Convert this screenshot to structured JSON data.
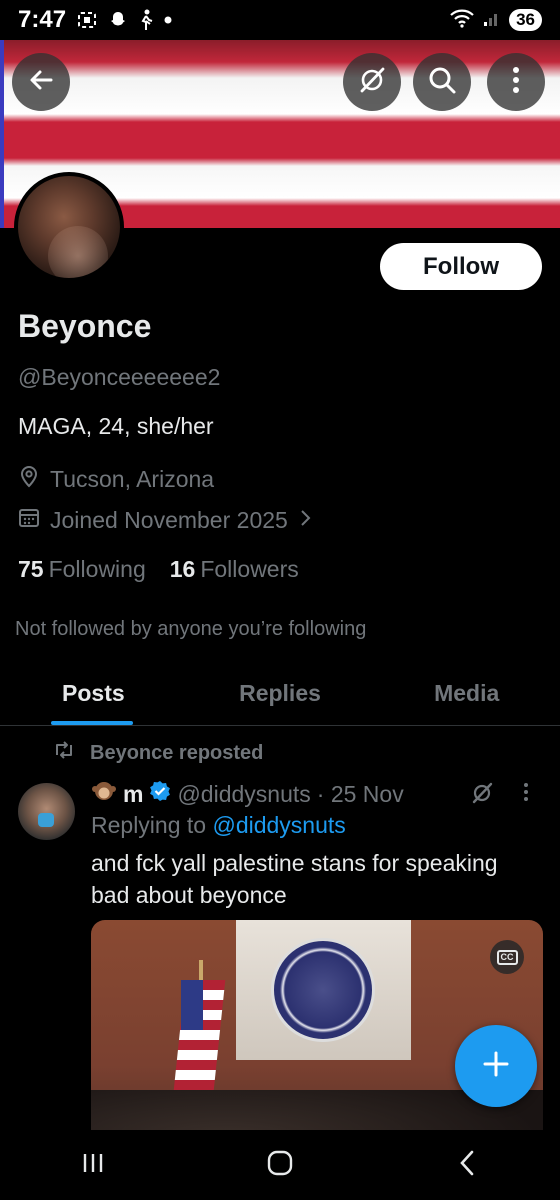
{
  "status_bar": {
    "time": "7:47",
    "battery": "36"
  },
  "header": {
    "back_icon": "arrow-left-icon",
    "grok_icon": "grok-slash-icon",
    "search_icon": "search-icon",
    "more_icon": "more-vertical-icon"
  },
  "profile": {
    "follow_label": "Follow",
    "display_name": "Beyonce",
    "handle": "@Beyonceeeeeee2",
    "bio": "MAGA, 24, she/her",
    "location": "Tucson, Arizona",
    "joined": "Joined November 2025",
    "following_count": "75",
    "following_label": "Following",
    "followers_count": "16",
    "followers_label": "Followers",
    "not_followed_text": "Not followed by anyone you’re following"
  },
  "tabs": [
    {
      "label": "Posts",
      "active": true
    },
    {
      "label": "Replies",
      "active": false
    },
    {
      "label": "Media",
      "active": false
    }
  ],
  "post": {
    "repost_label": "Beyonce reposted",
    "author_name": "m",
    "author_handle": "@diddysnuts",
    "time": "· 25 Nov",
    "replying_prefix": "Replying to ",
    "replying_to": "@diddysnuts",
    "text": "and fck yall palestine stans for speaking bad about beyonce",
    "cc_label": "CC"
  },
  "colors": {
    "accent": "#1d9bf0",
    "background": "#000000",
    "text_primary": "#e7e9ea",
    "text_secondary": "#71767b"
  }
}
